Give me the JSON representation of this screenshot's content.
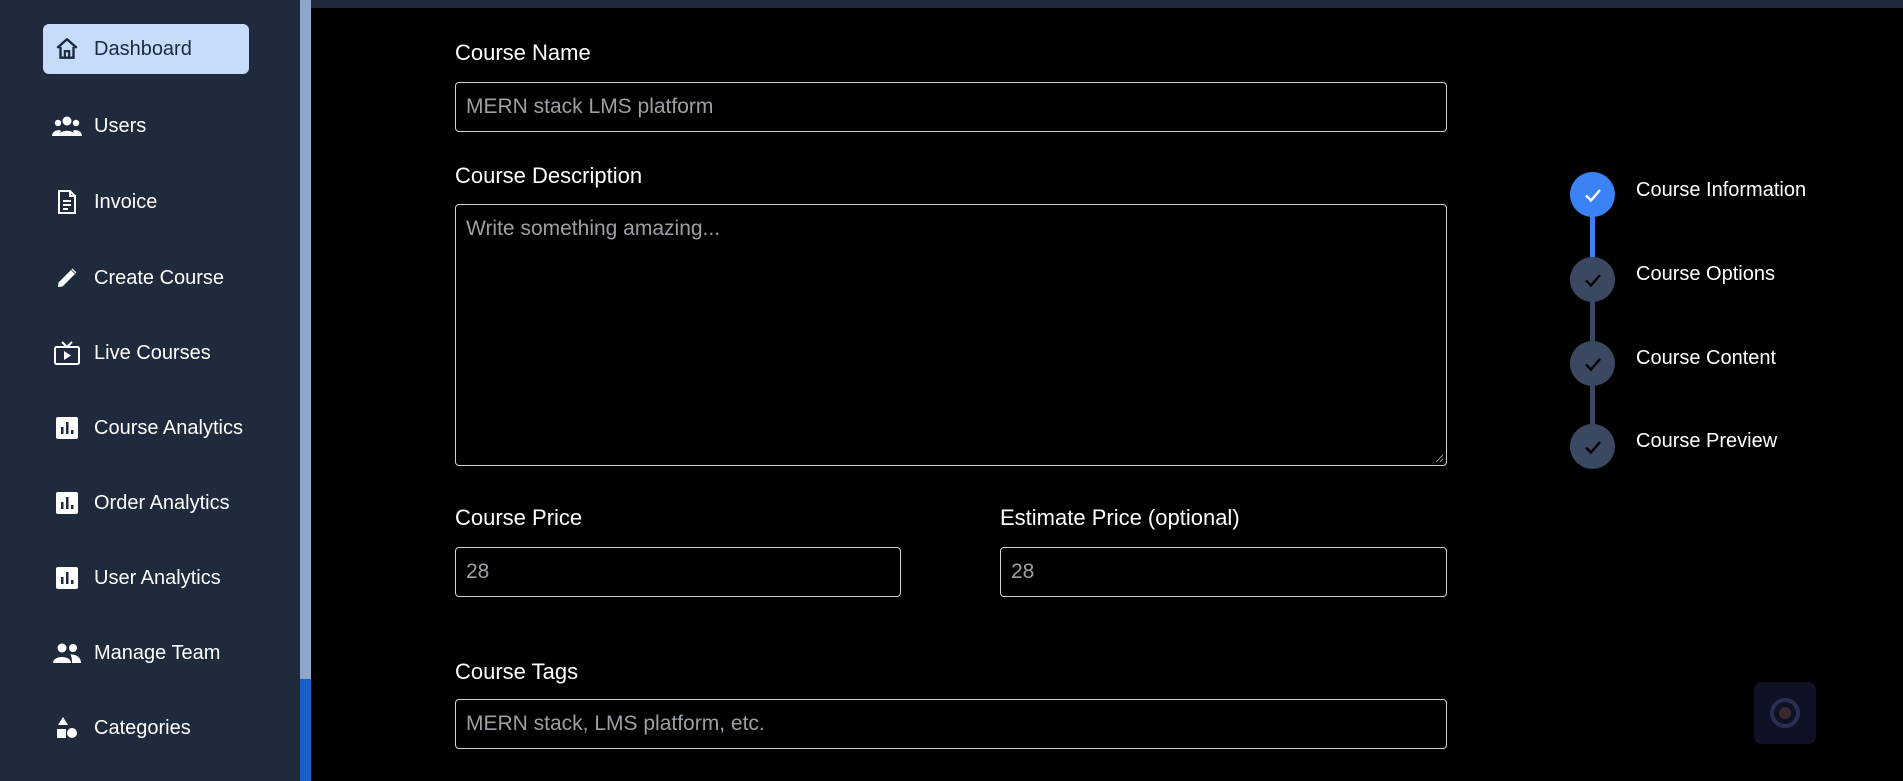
{
  "sidebar": {
    "items": [
      {
        "label": "Dashboard",
        "icon": "home-icon",
        "active": true
      },
      {
        "label": "Users",
        "icon": "users-icon"
      },
      {
        "label": "Invoice",
        "icon": "invoice-icon"
      },
      {
        "label": "Create Course",
        "icon": "pencil-icon"
      },
      {
        "label": "Live Courses",
        "icon": "live-tv-icon"
      },
      {
        "label": "Course Analytics",
        "icon": "bar-chart-icon"
      },
      {
        "label": "Order Analytics",
        "icon": "bar-chart-icon"
      },
      {
        "label": "User Analytics",
        "icon": "bar-chart-icon"
      },
      {
        "label": "Manage Team",
        "icon": "team-icon"
      },
      {
        "label": "Categories",
        "icon": "categories-icon"
      }
    ]
  },
  "form": {
    "course_name_label": "Course Name",
    "course_name_value": "MERN stack LMS platform",
    "description_label": "Course Description",
    "description_placeholder": "Write something amazing...",
    "price_label": "Course Price",
    "price_value": "28",
    "estimate_label": "Estimate Price (optional)",
    "estimate_value": "28",
    "tags_label": "Course Tags",
    "tags_placeholder": "MERN stack, LMS platform, etc."
  },
  "steps": [
    {
      "label": "Course Information",
      "active": true
    },
    {
      "label": "Course Options"
    },
    {
      "label": "Course Content"
    },
    {
      "label": "Course Preview"
    }
  ],
  "colors": {
    "sidebar_bg": "#1f2a3c",
    "active_item_bg": "#c7dcfb",
    "accent": "#3b82f6",
    "step_inactive": "#3a4862"
  }
}
